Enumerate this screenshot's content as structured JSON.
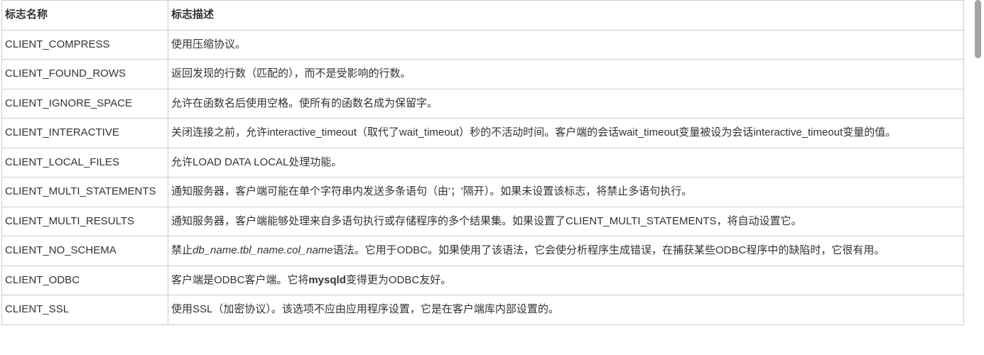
{
  "table": {
    "headers": {
      "name": "标志名称",
      "description": "标志描述"
    },
    "rows": [
      {
        "name": "CLIENT_COMPRESS",
        "desc_html": "使用压缩协议。"
      },
      {
        "name": "CLIENT_FOUND_ROWS",
        "desc_html": "返回发现的行数（匹配的），而不是受影响的行数。"
      },
      {
        "name": "CLIENT_IGNORE_SPACE",
        "desc_html": "允许在函数名后使用空格。使所有的函数名成为保留字。"
      },
      {
        "name": "CLIENT_INTERACTIVE",
        "desc_html": "关闭连接之前，允许interactive_timeout（取代了wait_timeout）秒的不活动时间。客户端的会话wait_timeout变量被设为会话interactive_timeout变量的值。"
      },
      {
        "name": "CLIENT_LOCAL_FILES",
        "desc_html": "允许LOAD DATA LOCAL处理功能。"
      },
      {
        "name": "CLIENT_MULTI_STATEMENTS",
        "desc_html": "通知服务器，客户端可能在单个字符串内发送多条语句（由'；'隔开）。如果未设置该标志，将禁止多语句执行。"
      },
      {
        "name": "CLIENT_MULTI_RESULTS",
        "desc_html": "通知服务器，客户端能够处理来自多语句执行或存储程序的多个结果集。如果设置了CLIENT_MULTI_STATEMENTS，将自动设置它。"
      },
      {
        "name": "CLIENT_NO_SCHEMA",
        "desc_html": "禁止<span class=\"italic\">db_name.tbl_name.col_name</span>语法。它用于ODBC。如果使用了该语法，它会使分析程序生成错误，在捕获某些ODBC程序中的缺陷时，它很有用。"
      },
      {
        "name": "CLIENT_ODBC",
        "desc_html": "客户端是ODBC客户端。它将<span class=\"bold\">mysqld</span>变得更为ODBC友好。"
      },
      {
        "name": "CLIENT_SSL",
        "desc_html": "使用SSL（加密协议）。该选项不应由应用程序设置，它是在客户端库内部设置的。"
      }
    ]
  }
}
